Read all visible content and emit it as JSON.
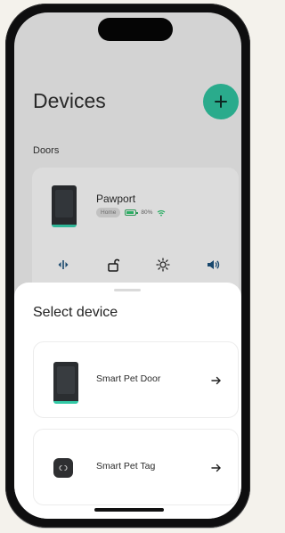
{
  "header": {
    "title": "Devices",
    "add_icon": "plus-icon"
  },
  "doors_section": {
    "label": "Doors",
    "device": {
      "name": "Pawport",
      "location_badge": "Home",
      "battery_percent": "80%",
      "battery_level": 0.8,
      "wifi_icon": "wifi-icon",
      "controls": [
        "mode-icon",
        "unlock-icon",
        "light-icon",
        "sound-icon"
      ]
    }
  },
  "sheet": {
    "title": "Select device",
    "options": [
      {
        "label": "Smart Pet Door",
        "icon": "pet-door-icon",
        "arrow": "arrow-right-icon"
      },
      {
        "label": "Smart Pet Tag",
        "icon": "pet-tag-icon",
        "arrow": "arrow-right-icon"
      }
    ]
  },
  "colors": {
    "accent": "#2fbc9a",
    "battery": "#2fbf6d",
    "background": "#e8e8e8",
    "sheet": "#ffffff"
  }
}
